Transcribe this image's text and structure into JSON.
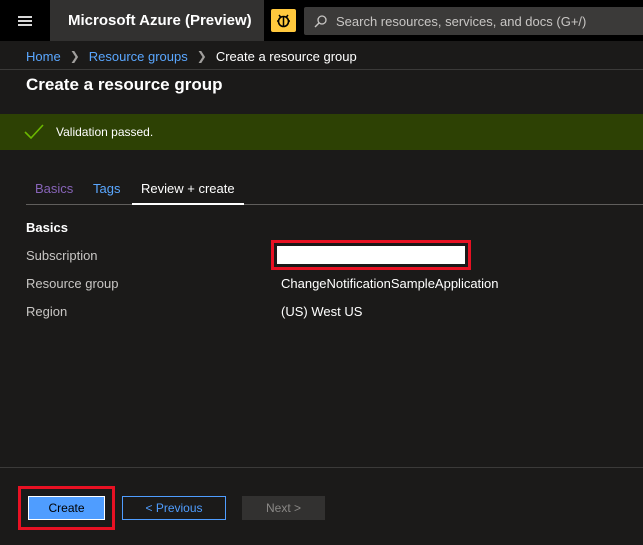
{
  "topbar": {
    "brand": "Microsoft Azure (Preview)",
    "search_placeholder": "Search resources, services, and docs (G+/)"
  },
  "breadcrumb": {
    "items": [
      "Home",
      "Resource groups",
      "Create a resource group"
    ]
  },
  "page": {
    "title": "Create a resource group"
  },
  "banner": {
    "text": "Validation passed.",
    "color": "#2d4104"
  },
  "tabs": [
    {
      "label": "Basics"
    },
    {
      "label": "Tags"
    },
    {
      "label": "Review + create",
      "active": true
    }
  ],
  "basics": {
    "section_title": "Basics",
    "rows": [
      {
        "label": "Subscription",
        "value": ""
      },
      {
        "label": "Resource group",
        "value": "ChangeNotificationSampleApplication"
      },
      {
        "label": "Region",
        "value": "(US) West US"
      }
    ]
  },
  "footer": {
    "create_label": "Create",
    "previous_label": "< Previous",
    "next_label": "Next >"
  },
  "colors": {
    "accent": "#4f9dff",
    "highlight": "#e81123",
    "preview_badge": "#ffc83d"
  },
  "icons": [
    "menu-icon",
    "preview-bug-icon",
    "search-icon",
    "checkmark-icon",
    "chevron-right-icon"
  ]
}
